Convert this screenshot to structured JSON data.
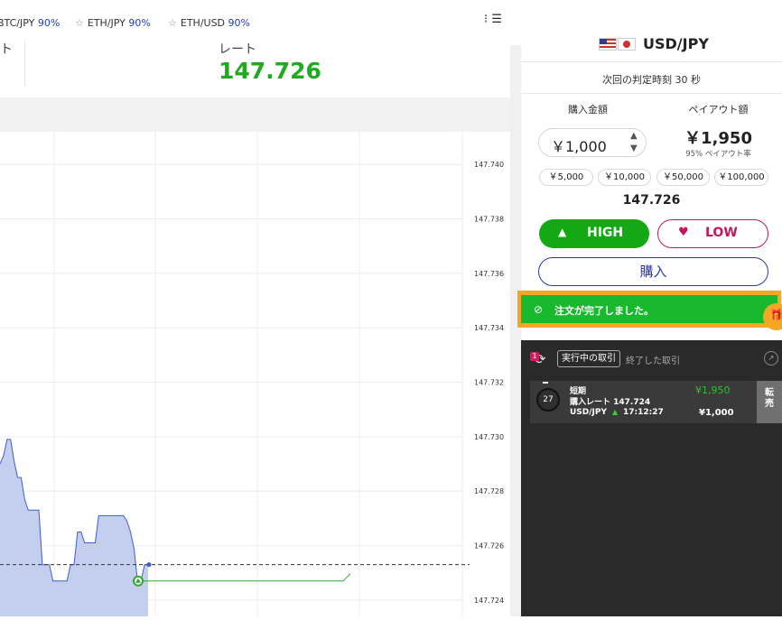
{
  "top_bar": {
    "pairs": [
      {
        "name": "BTC/JPY",
        "pct": "90%"
      },
      {
        "name": "ETH/JPY",
        "pct": "90%"
      },
      {
        "name": "ETH/USD",
        "pct": "90%"
      }
    ],
    "menu_icon": "menu-icon"
  },
  "rate_header": {
    "left_label": "ト",
    "label": "レート",
    "value": "147.726"
  },
  "chart_data": {
    "type": "area",
    "y_ticks": [
      "147.740",
      "147.738",
      "147.736",
      "147.734",
      "147.732",
      "147.730",
      "147.728",
      "147.726",
      "147.724"
    ],
    "ylim": [
      147.7234,
      147.7412
    ],
    "series": [
      {
        "values": [
          147.729,
          147.7293,
          147.7299,
          147.7299,
          147.7291,
          147.7285,
          147.7285,
          147.7277,
          147.7273,
          147.7273,
          147.7273,
          147.7273,
          147.7253,
          147.7253,
          147.7253,
          147.7247,
          147.7247,
          147.7247,
          147.7247,
          147.7247,
          147.7253,
          147.7253,
          147.7265,
          147.7265,
          147.7261,
          147.7261,
          147.7261,
          147.7261,
          147.7271,
          147.7271,
          147.7271,
          147.7271,
          147.7271,
          147.7271,
          147.7271,
          147.7271,
          147.7269,
          147.7265,
          147.7259,
          147.7247,
          147.7247,
          147.7253,
          147.7253
        ]
      }
    ],
    "entry_rate": 147.7247,
    "current_rate": 147.7253,
    "colors": {
      "line": "#3b5fc9",
      "fill": "#c4cff0",
      "entry_line": "#2ea82e",
      "dashed": "#333333"
    }
  },
  "panel": {
    "pair": "USD/JPY",
    "judge_text": "次回の判定時刻 30 秒",
    "buy_amount_label": "購入金額",
    "payout_label": "ペイアウト額",
    "amount": "￥1,000",
    "payout": "￥1,950",
    "payout_rate": "95% ペイアウト率",
    "quick_amounts": [
      "￥5,000",
      "￥10,000",
      "￥50,000",
      "￥100,000"
    ],
    "current_rate": "147.726",
    "high_label": "HIGH",
    "low_label": "LOW",
    "purchase_label": "購入",
    "toast": "注文が完了しました。",
    "colors": {
      "high": "#14a814",
      "low": "#c2185b",
      "purchase": "#2e3a9e",
      "toast": "#19b92e",
      "toast_border": "#f5a623"
    }
  },
  "trades": {
    "badge": "1",
    "tab_active": "実行中の取引",
    "tab_closed": "終了した取引",
    "row": {
      "timer": "27",
      "kind": "短期",
      "rate": "購入レート 147.724",
      "pair": "USD/JPY",
      "time": "17:12:27",
      "payout": "¥1,950",
      "amount": "¥1,000",
      "resell": "転売"
    }
  }
}
